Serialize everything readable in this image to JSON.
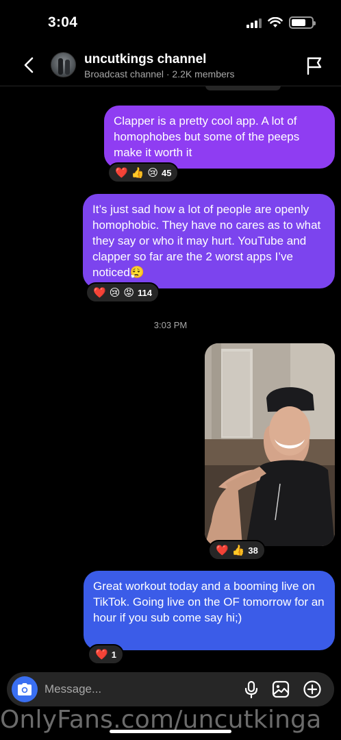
{
  "status_bar": {
    "time": "3:04",
    "battery_level": 0.7
  },
  "header": {
    "channel_name": "uncutkings channel",
    "subtitle": "Broadcast channel · 2.2K members",
    "icons": {
      "back": "chevron-left-icon",
      "report": "flag-icon",
      "avatar": "channel-avatar"
    }
  },
  "messages": [
    {
      "text": "Clapper is a pretty cool app. A lot of homophobes but some of the peeps make it worth it",
      "reactions": [
        "❤️",
        "👍",
        "😢"
      ],
      "count": "45"
    },
    {
      "text": "It’s just sad how a lot of people are openly homophobic. They have no cares as to what they say or who it may hurt. YouTube and clapper so far are the 2 worst apps I’ve noticed😮‍💨",
      "reactions": [
        "❤️",
        "😢",
        "😡"
      ],
      "count": "114"
    }
  ],
  "timestamp": "3:03 PM",
  "photo_message": {
    "reactions": [
      "❤️",
      "👍"
    ],
    "count": "38"
  },
  "last_message": {
    "text": "Great workout today and a booming live on TikTok. Going live on the OF tomorrow for an hour if you sub come say hi;)",
    "reactions": [
      "❤️"
    ],
    "count": "1"
  },
  "composer": {
    "placeholder": "Message...",
    "icons": [
      "camera-icon",
      "microphone-icon",
      "image-icon",
      "add-icon"
    ]
  },
  "watermark": "OnlyFans.com/uncutkinga",
  "colors": {
    "bubble_purple": "#8f3df2",
    "bubble_violet": "#7c44ee",
    "bubble_blue": "#3b5ce8",
    "camera_blue": "#3a6ff1",
    "reaction_bg": "#262626"
  }
}
